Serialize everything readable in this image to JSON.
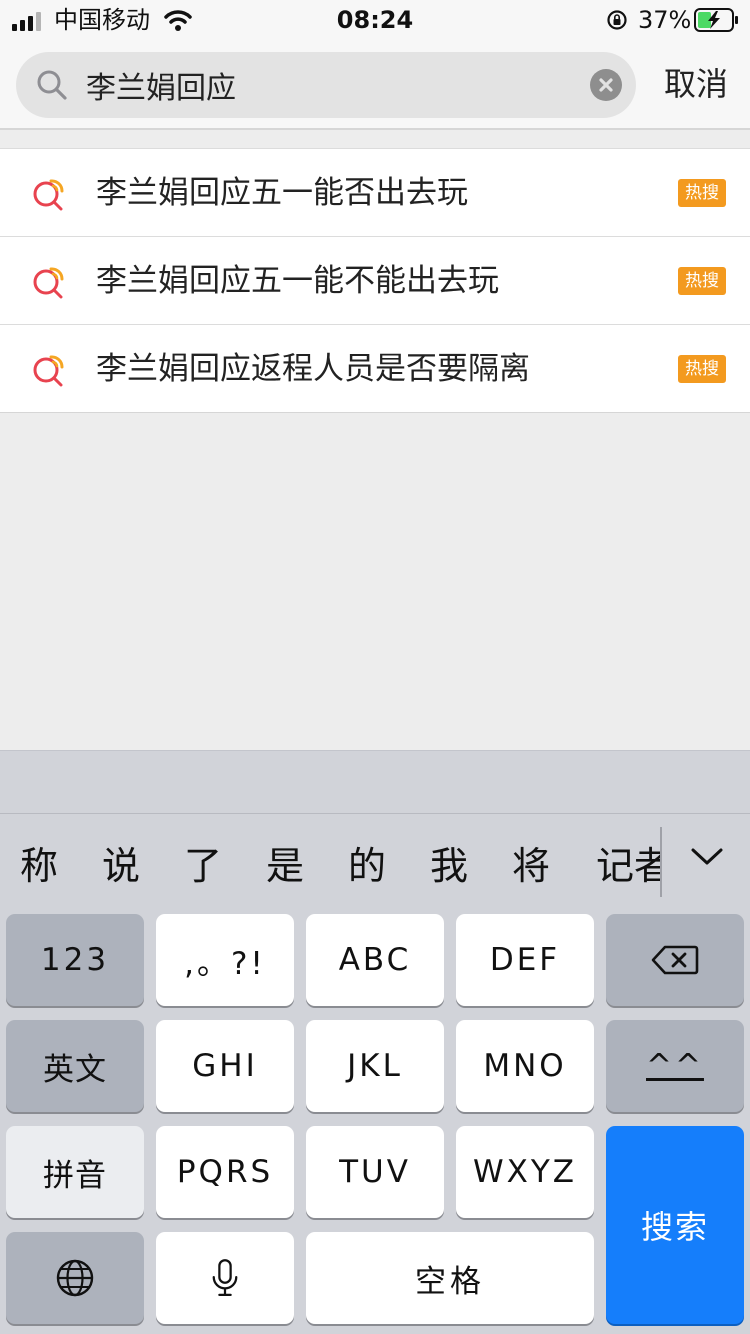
{
  "status_bar": {
    "carrier": "中国移动",
    "time": "08:24",
    "battery": "37%"
  },
  "search": {
    "query": "李兰娟回应",
    "cancel": "取消"
  },
  "suggestions": [
    {
      "text": "李兰娟回应五一能否出去玩",
      "badge": "热搜"
    },
    {
      "text": "李兰娟回应五一能不能出去玩",
      "badge": "热搜"
    },
    {
      "text": "李兰娟回应返程人员是否要隔离",
      "badge": "热搜"
    }
  ],
  "keyboard": {
    "candidates": [
      "称",
      "说",
      "了",
      "是",
      "的",
      "我",
      "将",
      "记者"
    ],
    "keys": {
      "num": "123",
      "punct": ",。?!",
      "abc": "ABC",
      "def": "DEF",
      "english": "英文",
      "ghi": "GHI",
      "jkl": "JKL",
      "mno": "MNO",
      "emoji": "^^",
      "pinyin": "拼音",
      "pqrs": "PQRS",
      "tuv": "TUV",
      "wxyz": "WXYZ",
      "search": "搜索",
      "space": "空格"
    }
  },
  "colors": {
    "hot_badge": "#f39a1f",
    "search_key": "#157efb"
  }
}
